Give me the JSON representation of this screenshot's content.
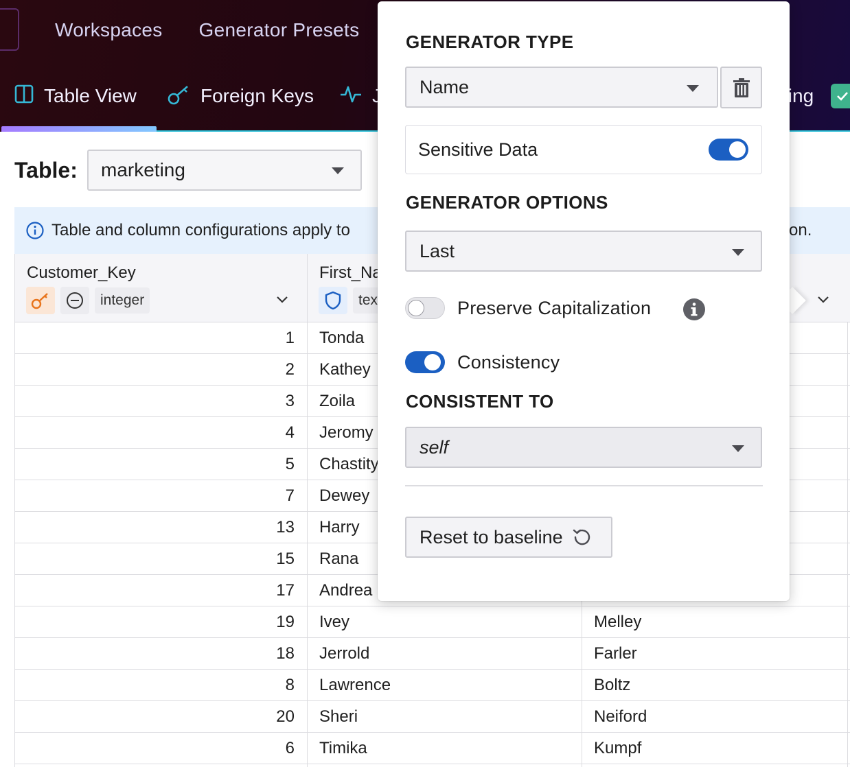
{
  "topnav": {
    "items": [
      "Workspaces",
      "Generator Presets"
    ]
  },
  "tabs": [
    {
      "label": "Table View",
      "icon": "columns-icon"
    },
    {
      "label": "Foreign Keys",
      "icon": "key-icon"
    },
    {
      "label": "J",
      "icon": "activity-icon"
    },
    {
      "label": "ting"
    }
  ],
  "table_selector": {
    "label": "Table:",
    "value": "marketing"
  },
  "banner": {
    "text": "Table and column configurations apply to",
    "tail": "on."
  },
  "columns": [
    {
      "name": "Customer_Key",
      "type": "integer"
    },
    {
      "name": "First_Na",
      "type": "text"
    }
  ],
  "rows": [
    {
      "key": "1",
      "first": "Tonda",
      "last": ""
    },
    {
      "key": "2",
      "first": "Kathey",
      "last": ""
    },
    {
      "key": "3",
      "first": "Zoila",
      "last": ""
    },
    {
      "key": "4",
      "first": "Jeromy",
      "last": ""
    },
    {
      "key": "5",
      "first": "Chastity",
      "last": ""
    },
    {
      "key": "7",
      "first": "Dewey",
      "last": ""
    },
    {
      "key": "13",
      "first": "Harry",
      "last": ""
    },
    {
      "key": "15",
      "first": "Rana",
      "last": ""
    },
    {
      "key": "17",
      "first": "Andrea",
      "last": ""
    },
    {
      "key": "19",
      "first": "Ivey",
      "last": "Melley"
    },
    {
      "key": "18",
      "first": "Jerrold",
      "last": "Farler"
    },
    {
      "key": "8",
      "first": "Lawrence",
      "last": "Boltz"
    },
    {
      "key": "20",
      "first": "Sheri",
      "last": "Neiford"
    },
    {
      "key": "6",
      "first": "Timika",
      "last": "Kumpf"
    },
    {
      "key": "",
      "first": "",
      "last": ""
    }
  ],
  "popover": {
    "generator_type_title": "GENERATOR TYPE",
    "generator_type_value": "Name",
    "sensitive_label": "Sensitive Data",
    "sensitive_on": true,
    "generator_options_title": "GENERATOR OPTIONS",
    "generator_options_value": "Last",
    "preserve_label": "Preserve Capitalization",
    "preserve_on": false,
    "consistency_label": "Consistency",
    "consistency_on": true,
    "consistent_to_title": "CONSISTENT TO",
    "consistent_to_value": "self",
    "reset_label": "Reset to baseline"
  },
  "colors": {
    "accent": "#1b5fc2",
    "key_badge": "#fbe6d6",
    "shield_badge": "#e4eefc",
    "check": "#3fb38d"
  }
}
